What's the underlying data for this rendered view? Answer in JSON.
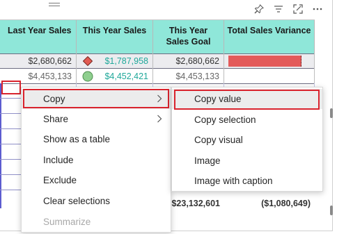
{
  "header": {
    "icons": [
      "pin-icon",
      "filter-icon",
      "focus-mode-icon",
      "more-options-icon"
    ]
  },
  "table": {
    "columns": [
      "Last Year Sales",
      "This Year Sales",
      "This Year Sales Goal",
      "Total Sales Variance"
    ],
    "column3_lines": [
      "This Year",
      "Sales Goal"
    ],
    "rows": [
      {
        "last_year": "$2,680,662",
        "this_year": "$1,787,958",
        "goal": "$2,680,662",
        "indicator": "diamond-red"
      },
      {
        "last_year": "$4,453,133",
        "this_year": "$4,452,421",
        "goal": "$4,453,133",
        "indicator": "circle-green"
      }
    ],
    "total": {
      "goal": "$23,132,601",
      "variance": "($1,080,649)"
    }
  },
  "context_menu": {
    "items": [
      {
        "label": "Copy",
        "has_submenu": true
      },
      {
        "label": "Share",
        "has_submenu": true
      },
      {
        "label": "Show as a table",
        "has_submenu": false
      },
      {
        "label": "Include",
        "has_submenu": false
      },
      {
        "label": "Exclude",
        "has_submenu": false
      },
      {
        "label": "Clear selections",
        "has_submenu": false
      },
      {
        "label": "Summarize",
        "has_submenu": false,
        "disabled": true
      }
    ]
  },
  "submenu": {
    "items": [
      {
        "label": "Copy value"
      },
      {
        "label": "Copy selection"
      },
      {
        "label": "Copy visual"
      },
      {
        "label": "Image"
      },
      {
        "label": "Image with caption"
      }
    ]
  },
  "colors": {
    "header_bg": "#8fe7d9",
    "highlight_red": "#d9232d",
    "variance_bar": "#e35a5a",
    "teal_text": "#1fa89a"
  }
}
